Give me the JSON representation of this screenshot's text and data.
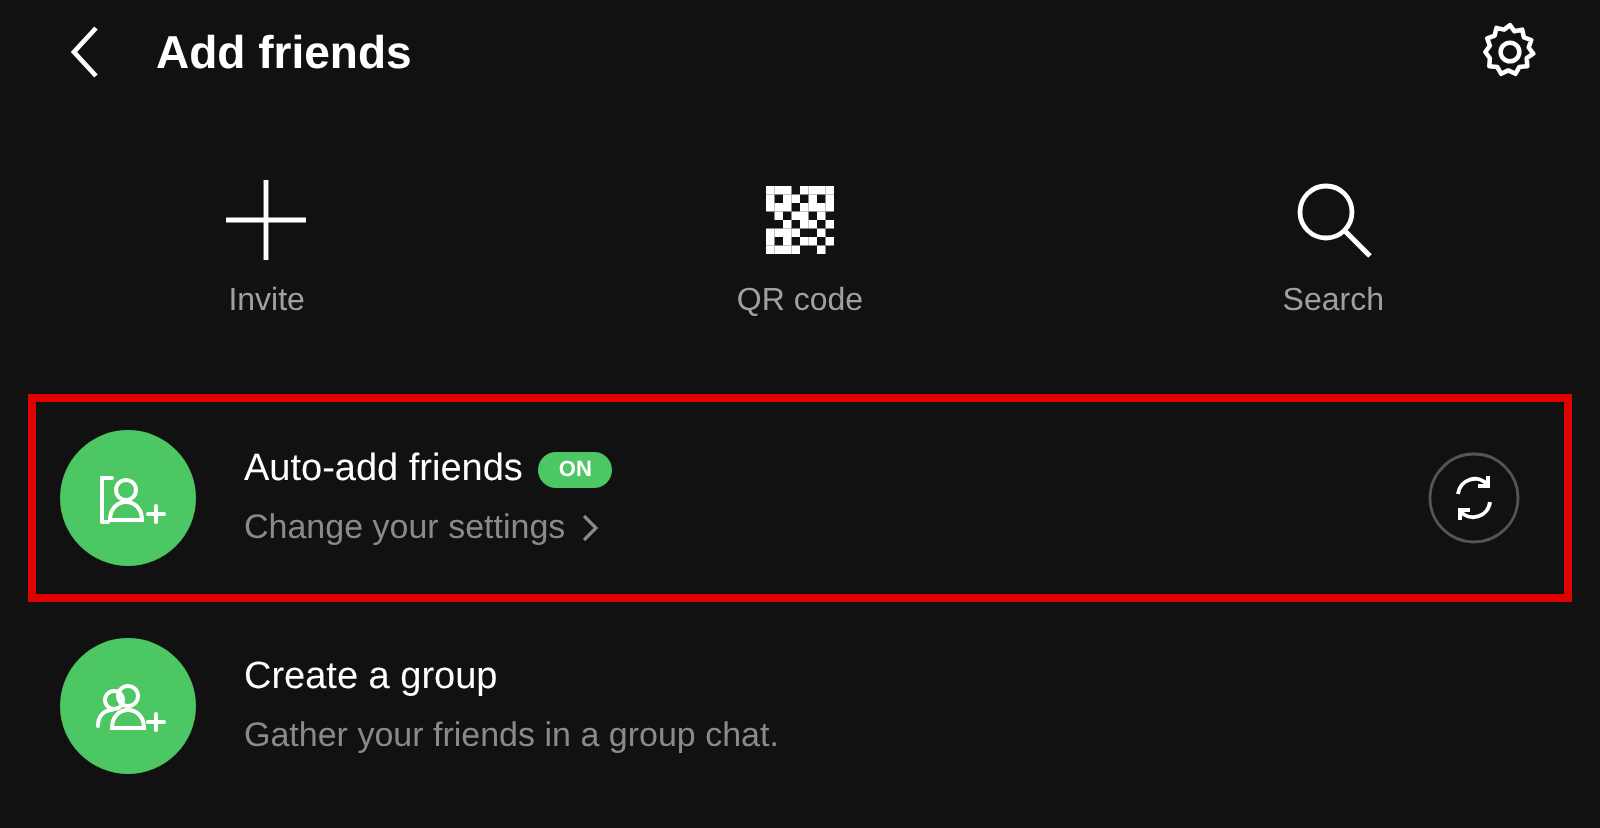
{
  "header": {
    "title": "Add friends"
  },
  "actions": [
    {
      "kind": "plus",
      "label": "Invite"
    },
    {
      "kind": "qr",
      "label": "QR code"
    },
    {
      "kind": "search",
      "label": "Search"
    }
  ],
  "rows": [
    {
      "kind": "setting",
      "title": "Auto-add friends",
      "badge": "ON",
      "subtitle": "Change your settings",
      "highlighted": true
    },
    {
      "kind": "action",
      "title": "Create a group",
      "subtitle": "Gather your friends in a group chat.",
      "highlighted": false
    }
  ]
}
